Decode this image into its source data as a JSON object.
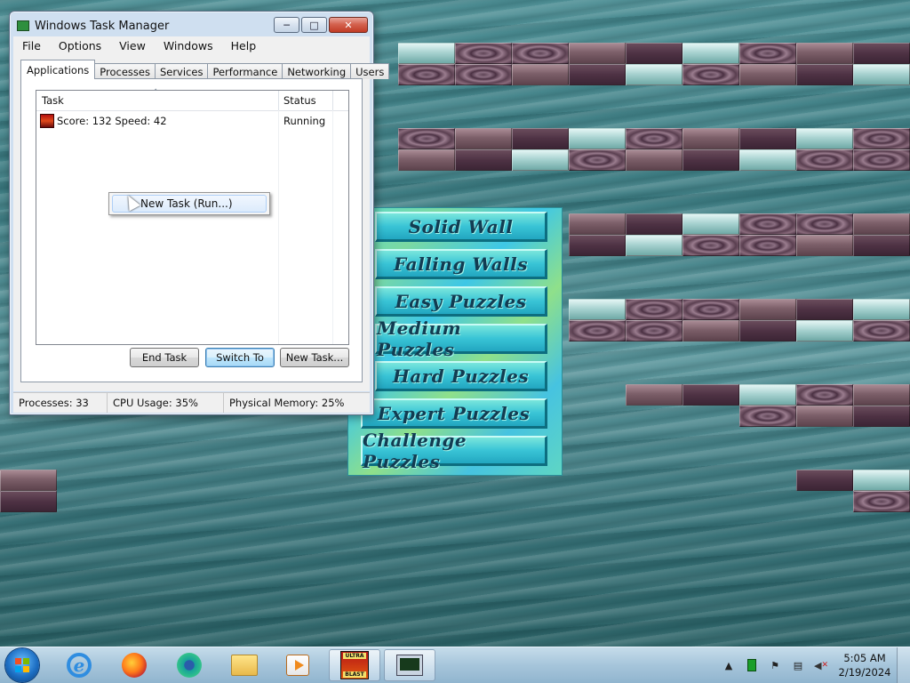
{
  "window": {
    "title": "Windows Task Manager",
    "minimize": "─",
    "maximize": "□",
    "close": "✕",
    "icon": "task-manager-icon"
  },
  "menubar": [
    "File",
    "Options",
    "View",
    "Windows",
    "Help"
  ],
  "tabs": [
    "Applications",
    "Processes",
    "Services",
    "Performance",
    "Networking",
    "Users"
  ],
  "active_tab": "Applications",
  "table": {
    "columns": [
      "Task",
      "Status"
    ],
    "sort_indicator": "ˆ",
    "rows": [
      {
        "task": "Score: 132 Speed: 42",
        "status": "Running",
        "icon": "game-app-icon"
      }
    ]
  },
  "context_menu": {
    "items": [
      "New Task (Run...)"
    ]
  },
  "buttons": {
    "end_task": "End Task",
    "switch_to": "Switch To",
    "new_task": "New Task..."
  },
  "statusbar": {
    "processes": "Processes: 33",
    "cpu": "CPU Usage: 35%",
    "memory": "Physical Memory: 25%"
  },
  "game_menu": {
    "items": [
      "Solid Wall",
      "Falling Walls",
      "Easy Puzzles",
      "Medium Puzzles",
      "Hard Puzzles",
      "Expert Puzzles",
      "Challenge Puzzles"
    ]
  },
  "taskbar": {
    "pinned": [
      "start-button",
      "internet-explorer-icon",
      "firefox-icon",
      "edge-chromium-icon",
      "file-explorer-icon",
      "media-player-icon"
    ],
    "running": [
      {
        "name": "ultra-blaster-game",
        "lines": [
          "ULTRA",
          "BLAST"
        ]
      },
      {
        "name": "task-manager",
        "active": true
      }
    ],
    "tray_icons": [
      "show-hidden-icons-arrow",
      "network-activity-icon",
      "action-center-flag-icon",
      "network-icon",
      "volume-muted-icon"
    ],
    "time": "5:05 AM",
    "date": "2/19/2024"
  },
  "colors": {
    "window_frame": "#cfdff0",
    "close_button": "#c13b25",
    "menu_button": "#39c4d6",
    "water": "#4e8f95"
  }
}
